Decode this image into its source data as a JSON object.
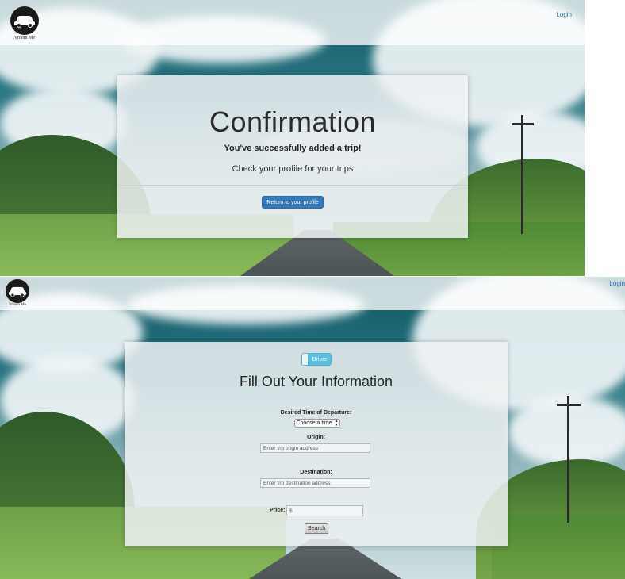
{
  "top_screen": {
    "logo": {
      "text": "Vroom Me",
      "icon": "car-icon"
    },
    "nav": {
      "login_label": "Login"
    },
    "confirmation": {
      "title": "Confirmation",
      "message": "You've successfully added a trip!",
      "hint": "Check your profile for your trips",
      "button_label": "Return to your profile"
    }
  },
  "bottom_screen": {
    "logo": {
      "text": "Vroom Me",
      "icon": "car-icon"
    },
    "nav": {
      "login_label": "Login"
    },
    "form": {
      "toggle_label": "Driver",
      "title": "Fill Out Your Information",
      "departure_label": "Desired Time of Departure:",
      "departure_selected": "Choose a time",
      "origin_label": "Origin:",
      "origin_placeholder": "Enter trip origin address",
      "destination_label": "Destination:",
      "destination_placeholder": "Enter trip destination address",
      "price_label": "Price:",
      "price_placeholder": "$",
      "search_label": "Search"
    }
  },
  "colors": {
    "primary_button": "#337ab7",
    "toggle_active": "#5bc0de",
    "link": "#2a6fb0"
  }
}
